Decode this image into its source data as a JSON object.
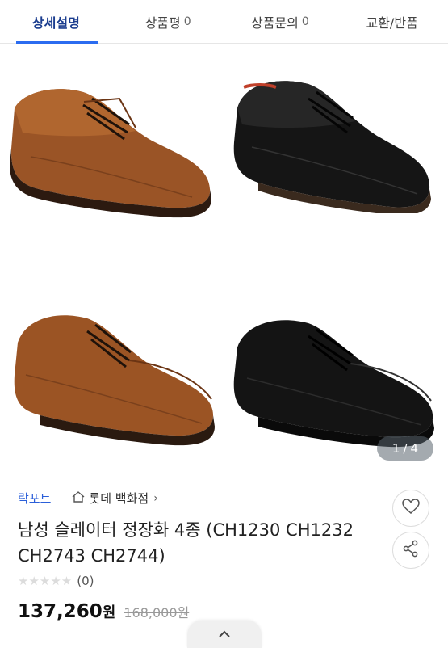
{
  "tabs": [
    {
      "label": "상세설명",
      "count": ""
    },
    {
      "label": "상품평",
      "count": "0"
    },
    {
      "label": "상품문의",
      "count": "0"
    },
    {
      "label": "교환/반품",
      "count": ""
    }
  ],
  "gallery": {
    "counter_current": "1",
    "counter_sep": "/",
    "counter_total": "4"
  },
  "product": {
    "brand": "락포트",
    "store": "롯데 백화점",
    "title": "남성 슬레이터 정장화 4종 (CH1230 CH1232 CH2743 CH2744)",
    "stars": "★★★★★",
    "rating_count": "(0)",
    "price": "137,260",
    "price_unit": "원",
    "original_price": "168,000원"
  },
  "colors": {
    "accent": "#2b6cf0",
    "brand": "#2b5fd9",
    "brown": "#8a4a22",
    "black": "#161616"
  }
}
